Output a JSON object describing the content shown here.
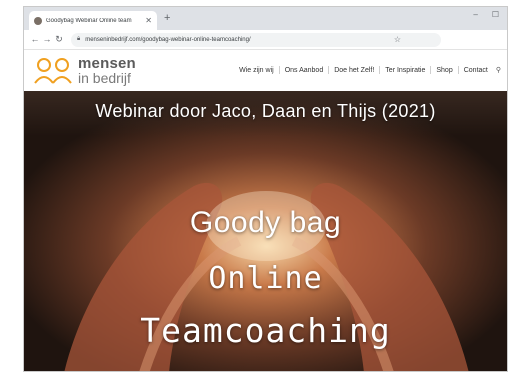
{
  "browser": {
    "tab_title": "Goodybag Webinar Online team",
    "tab_close_icon": "close-icon",
    "url": "menseninbedrijf.com/goodybag-webinar-online-teamcoaching/"
  },
  "site": {
    "logo": {
      "line1": "mensen",
      "line2": "in bedrijf",
      "color": "#f0a020"
    },
    "nav": [
      {
        "label": "Wie zijn wij"
      },
      {
        "label": "Ons Aanbod"
      },
      {
        "label": "Doe het Zelf!"
      },
      {
        "label": "Ter Inspiratie"
      },
      {
        "label": "Shop"
      },
      {
        "label": "Contact"
      }
    ]
  },
  "hero": {
    "title": "Webinar door Jaco, Daan en Thijs (2021)",
    "line1": "Goody bag",
    "line2": "Online",
    "line3": "Teamcoaching"
  }
}
